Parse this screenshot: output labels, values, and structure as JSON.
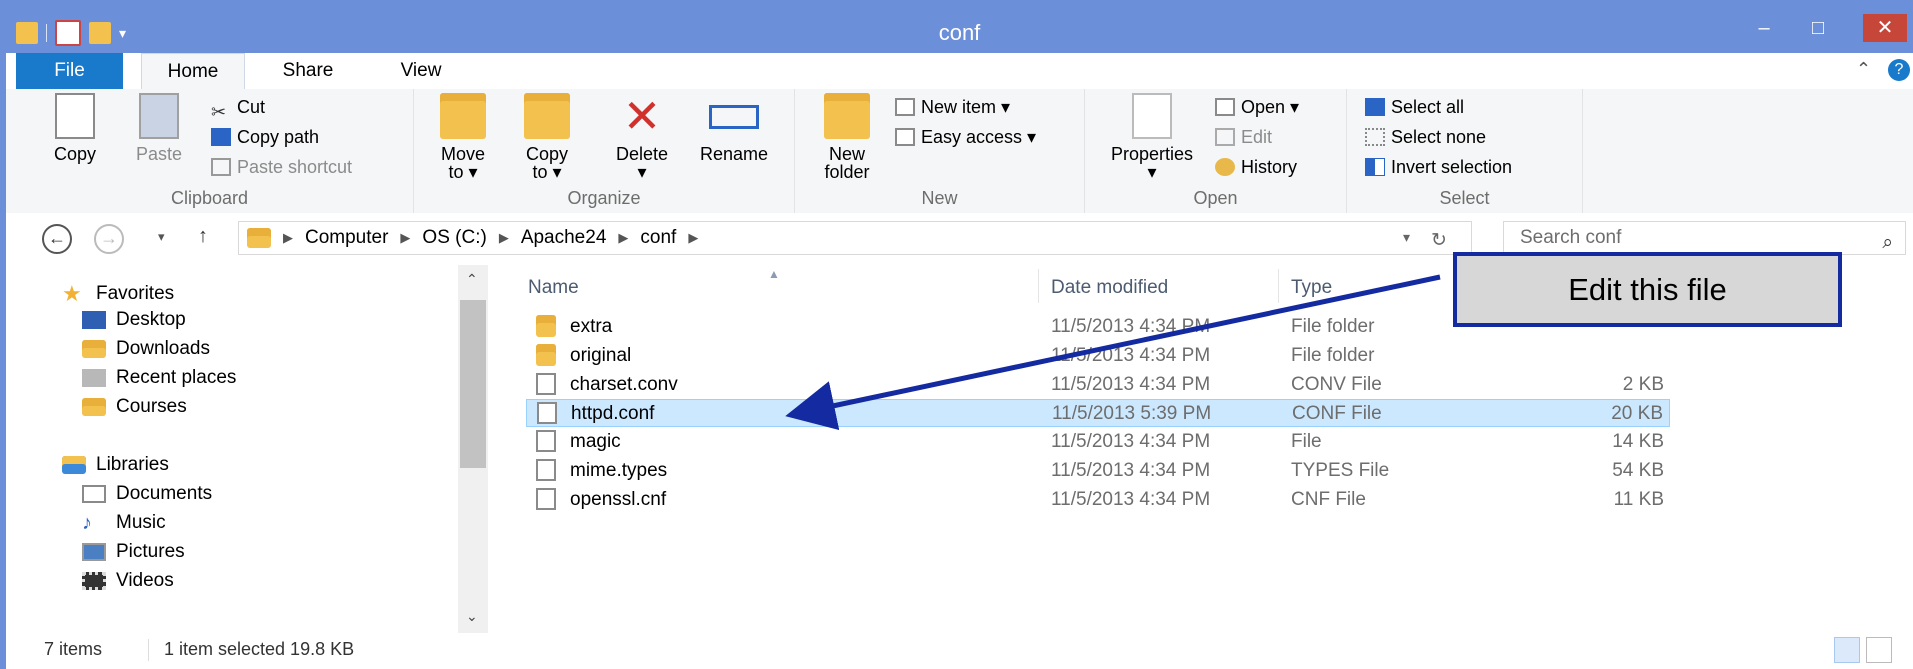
{
  "window": {
    "title": "conf"
  },
  "window_controls": {
    "minimize": "–",
    "maximize": "□",
    "close": "✕"
  },
  "tabs": [
    "File",
    "Home",
    "Share",
    "View"
  ],
  "ribbon": {
    "clipboard": {
      "label": "Clipboard",
      "copy": "Copy",
      "paste": "Paste",
      "cut": "Cut",
      "copy_path": "Copy path",
      "paste_shortcut": "Paste shortcut"
    },
    "organize": {
      "label": "Organize",
      "move_to": [
        "Move",
        "to ▾"
      ],
      "copy_to": [
        "Copy",
        "to ▾"
      ],
      "delete": "Delete",
      "rename": "Rename"
    },
    "new": {
      "label": "New",
      "new_folder": [
        "New",
        "folder"
      ],
      "new_item": "New item ▾",
      "easy_access": "Easy access ▾"
    },
    "open": {
      "label": "Open",
      "properties": "Properties",
      "open": "Open ▾",
      "edit": "Edit",
      "history": "History"
    },
    "select": {
      "label": "Select",
      "select_all": "Select all",
      "select_none": "Select none",
      "invert_selection": "Invert selection"
    }
  },
  "address": {
    "crumbs": [
      "Computer",
      "OS (C:)",
      "Apache24",
      "conf"
    ],
    "search_placeholder": "Search conf"
  },
  "nav": {
    "favorites": "Favorites",
    "favorites_items": [
      "Desktop",
      "Downloads",
      "Recent places",
      "Courses"
    ],
    "libraries": "Libraries",
    "libraries_items": [
      "Documents",
      "Music",
      "Pictures",
      "Videos"
    ]
  },
  "columns": {
    "name": "Name",
    "date": "Date modified",
    "type": "Type"
  },
  "files": [
    {
      "name": "extra",
      "date": "11/5/2013 4:34 PM",
      "type": "File folder",
      "size": "",
      "folder": true
    },
    {
      "name": "original",
      "date": "11/5/2013 4:34 PM",
      "type": "File folder",
      "size": "",
      "folder": true
    },
    {
      "name": "charset.conv",
      "date": "11/5/2013 4:34 PM",
      "type": "CONV File",
      "size": "2 KB",
      "folder": false
    },
    {
      "name": "httpd.conf",
      "date": "11/5/2013 5:39 PM",
      "type": "CONF File",
      "size": "20 KB",
      "folder": false,
      "selected": true
    },
    {
      "name": "magic",
      "date": "11/5/2013 4:34 PM",
      "type": "File",
      "size": "14 KB",
      "folder": false
    },
    {
      "name": "mime.types",
      "date": "11/5/2013 4:34 PM",
      "type": "TYPES File",
      "size": "54 KB",
      "folder": false
    },
    {
      "name": "openssl.cnf",
      "date": "11/5/2013 4:34 PM",
      "type": "CNF File",
      "size": "11 KB",
      "folder": false
    }
  ],
  "status": {
    "items": "7 items",
    "selected": "1 item selected  19.8 KB"
  },
  "callout": {
    "text": "Edit this file"
  },
  "colors": {
    "titlebar": "#6b8fd8",
    "file_tab": "#1979ca",
    "callout_border": "#142aa0",
    "selection": "#cce8ff"
  }
}
